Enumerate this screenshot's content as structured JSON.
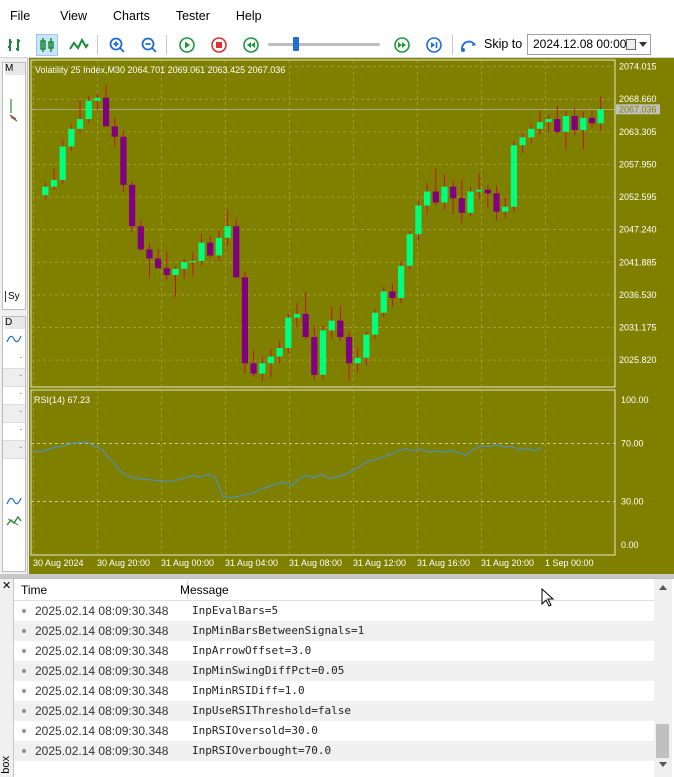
{
  "menu": [
    "File",
    "View",
    "Charts",
    "Tester",
    "Help"
  ],
  "toolbar": {
    "icons": [
      "bar-chart-icon",
      "candlestick-icon",
      "line-chart-icon",
      "zoom-in-icon",
      "zoom-out-icon",
      "play-icon",
      "stop-icon",
      "rewind-icon",
      "fast-forward-icon",
      "skip-end-icon",
      "skip-to-icon"
    ],
    "skip_label": "Skip to",
    "skip_date": "2024.12.08 00:00"
  },
  "left_strip": {
    "top_label": "M",
    "symbol_tab": "Sy",
    "data_tab": "D"
  },
  "chart_data": {
    "type": "candlestick",
    "title": "Volatility 25 Index,M30",
    "ohlc_header": "2064.701 2069.061 2063.425 2067.036",
    "price_axis": [
      "2074.015",
      "2068.660",
      "2063.305",
      "2057.950",
      "2052.595",
      "2047.240",
      "2041.885",
      "2036.530",
      "2031.175",
      "2025.820"
    ],
    "current_price_label": "2067.036",
    "ylim": [
      2021.4,
      2075.1
    ],
    "time_axis": [
      "30 Aug 2024",
      "30 Aug 20:00",
      "31 Aug 00:00",
      "31 Aug 04:00",
      "31 Aug 08:00",
      "31 Aug 12:00",
      "31 Aug 16:00",
      "31 Aug 20:00",
      "1 Sep 00:00"
    ],
    "colors": {
      "background": "#808000",
      "bull": "#00ff7f",
      "bear": "#800080",
      "grid": "#a8a854",
      "axis_text": "#ffffff",
      "rsi_line": "#4a90c9"
    },
    "candles": [
      {
        "o": 2052.9,
        "h": 2055.0,
        "l": 2052.2,
        "c": 2054.3
      },
      {
        "o": 2054.3,
        "h": 2057.3,
        "l": 2053.8,
        "c": 2055.4
      },
      {
        "o": 2055.4,
        "h": 2062.0,
        "l": 2054.8,
        "c": 2060.9
      },
      {
        "o": 2060.9,
        "h": 2064.5,
        "l": 2060.2,
        "c": 2063.8
      },
      {
        "o": 2063.8,
        "h": 2068.5,
        "l": 2063.1,
        "c": 2065.4
      },
      {
        "o": 2065.4,
        "h": 2069.2,
        "l": 2064.8,
        "c": 2068.4
      },
      {
        "o": 2068.4,
        "h": 2069.5,
        "l": 2066.9,
        "c": 2068.9
      },
      {
        "o": 2068.9,
        "h": 2071.0,
        "l": 2064.2,
        "c": 2064.2
      },
      {
        "o": 2064.2,
        "h": 2065.7,
        "l": 2060.9,
        "c": 2062.5
      },
      {
        "o": 2062.5,
        "h": 2063.5,
        "l": 2053.4,
        "c": 2054.6
      },
      {
        "o": 2054.6,
        "h": 2055.2,
        "l": 2046.8,
        "c": 2047.8
      },
      {
        "o": 2047.8,
        "h": 2048.8,
        "l": 2043.8,
        "c": 2044.0
      },
      {
        "o": 2044.0,
        "h": 2045.1,
        "l": 2039.4,
        "c": 2042.5
      },
      {
        "o": 2042.5,
        "h": 2044.1,
        "l": 2040.9,
        "c": 2040.9
      },
      {
        "o": 2040.9,
        "h": 2043.7,
        "l": 2038.9,
        "c": 2039.8
      },
      {
        "o": 2039.8,
        "h": 2041.2,
        "l": 2036.2,
        "c": 2040.8
      },
      {
        "o": 2040.8,
        "h": 2042.4,
        "l": 2039.2,
        "c": 2041.9
      },
      {
        "o": 2041.9,
        "h": 2043.5,
        "l": 2039.7,
        "c": 2042.1
      },
      {
        "o": 2042.1,
        "h": 2046.5,
        "l": 2041.2,
        "c": 2045.1
      },
      {
        "o": 2045.1,
        "h": 2046.2,
        "l": 2042.5,
        "c": 2043.0
      },
      {
        "o": 2043.0,
        "h": 2047.2,
        "l": 2042.0,
        "c": 2045.9
      },
      {
        "o": 2045.9,
        "h": 2050.5,
        "l": 2044.6,
        "c": 2047.8
      },
      {
        "o": 2047.8,
        "h": 2049.0,
        "l": 2039.4,
        "c": 2039.4
      },
      {
        "o": 2039.4,
        "h": 2040.3,
        "l": 2023.6,
        "c": 2025.3
      },
      {
        "o": 2025.3,
        "h": 2027.4,
        "l": 2023.1,
        "c": 2023.6
      },
      {
        "o": 2023.6,
        "h": 2026.4,
        "l": 2022.3,
        "c": 2025.3
      },
      {
        "o": 2025.3,
        "h": 2027.6,
        "l": 2023.0,
        "c": 2026.4
      },
      {
        "o": 2026.4,
        "h": 2029.0,
        "l": 2025.3,
        "c": 2027.8
      },
      {
        "o": 2027.8,
        "h": 2033.5,
        "l": 2026.9,
        "c": 2032.8
      },
      {
        "o": 2032.8,
        "h": 2035.2,
        "l": 2031.1,
        "c": 2033.4
      },
      {
        "o": 2033.4,
        "h": 2037.0,
        "l": 2029.2,
        "c": 2029.6
      },
      {
        "o": 2029.6,
        "h": 2031.5,
        "l": 2022.6,
        "c": 2023.4
      },
      {
        "o": 2023.4,
        "h": 2031.5,
        "l": 2022.8,
        "c": 2030.7
      },
      {
        "o": 2030.7,
        "h": 2034.5,
        "l": 2029.3,
        "c": 2032.3
      },
      {
        "o": 2032.3,
        "h": 2034.8,
        "l": 2028.9,
        "c": 2029.6
      },
      {
        "o": 2029.6,
        "h": 2030.6,
        "l": 2022.4,
        "c": 2025.3
      },
      {
        "o": 2025.3,
        "h": 2027.8,
        "l": 2023.8,
        "c": 2026.2
      },
      {
        "o": 2026.2,
        "h": 2030.5,
        "l": 2025.0,
        "c": 2030.0
      },
      {
        "o": 2030.0,
        "h": 2034.2,
        "l": 2029.3,
        "c": 2033.6
      },
      {
        "o": 2033.6,
        "h": 2037.8,
        "l": 2032.9,
        "c": 2037.1
      },
      {
        "o": 2037.1,
        "h": 2038.4,
        "l": 2034.6,
        "c": 2036.0
      },
      {
        "o": 2036.0,
        "h": 2042.0,
        "l": 2035.2,
        "c": 2041.3
      },
      {
        "o": 2041.3,
        "h": 2047.0,
        "l": 2040.6,
        "c": 2046.5
      },
      {
        "o": 2046.5,
        "h": 2052.0,
        "l": 2045.3,
        "c": 2051.2
      },
      {
        "o": 2051.2,
        "h": 2054.9,
        "l": 2049.8,
        "c": 2053.5
      },
      {
        "o": 2053.5,
        "h": 2057.3,
        "l": 2051.2,
        "c": 2051.7
      },
      {
        "o": 2051.7,
        "h": 2056.4,
        "l": 2050.5,
        "c": 2054.3
      },
      {
        "o": 2054.3,
        "h": 2055.3,
        "l": 2049.8,
        "c": 2052.4
      },
      {
        "o": 2052.4,
        "h": 2055.4,
        "l": 2048.3,
        "c": 2050.0
      },
      {
        "o": 2050.0,
        "h": 2054.3,
        "l": 2049.4,
        "c": 2053.5
      },
      {
        "o": 2053.5,
        "h": 2056.5,
        "l": 2052.2,
        "c": 2053.8
      },
      {
        "o": 2053.8,
        "h": 2054.6,
        "l": 2050.9,
        "c": 2053.2
      },
      {
        "o": 2053.2,
        "h": 2054.5,
        "l": 2048.7,
        "c": 2050.2
      },
      {
        "o": 2050.2,
        "h": 2052.5,
        "l": 2049.2,
        "c": 2051.0
      },
      {
        "o": 2051.0,
        "h": 2061.8,
        "l": 2050.2,
        "c": 2061.1
      },
      {
        "o": 2061.1,
        "h": 2063.0,
        "l": 2059.8,
        "c": 2062.4
      },
      {
        "o": 2062.4,
        "h": 2064.6,
        "l": 2061.5,
        "c": 2063.8
      },
      {
        "o": 2063.8,
        "h": 2066.8,
        "l": 2062.8,
        "c": 2064.9
      },
      {
        "o": 2064.9,
        "h": 2066.1,
        "l": 2063.2,
        "c": 2065.4
      },
      {
        "o": 2065.4,
        "h": 2067.6,
        "l": 2063.0,
        "c": 2063.3
      },
      {
        "o": 2063.3,
        "h": 2066.8,
        "l": 2060.4,
        "c": 2065.9
      },
      {
        "o": 2065.9,
        "h": 2067.2,
        "l": 2062.7,
        "c": 2063.6
      },
      {
        "o": 2063.6,
        "h": 2066.7,
        "l": 2060.4,
        "c": 2065.6
      },
      {
        "o": 2065.6,
        "h": 2066.8,
        "l": 2064.0,
        "c": 2064.7
      },
      {
        "o": 2064.7,
        "h": 2069.1,
        "l": 2063.4,
        "c": 2067.0
      }
    ],
    "rsi": {
      "label": "RSI(14) 67.23",
      "axis": [
        "100.00",
        "70.00",
        "30.00",
        "0.00"
      ],
      "levels": [
        70,
        30
      ],
      "values": [
        64.8,
        64.2,
        66.1,
        67.5,
        68.3,
        69.9,
        70.6,
        71.2,
        68.1,
        66.4,
        60.1,
        53.9,
        48.6,
        46.5,
        45.7,
        45.1,
        44.6,
        44.3,
        43.8,
        44.9,
        46.2,
        47.9,
        46.8,
        48.6,
        46.4,
        33.6,
        32.7,
        33.4,
        34.9,
        35.8,
        38.4,
        40.2,
        42.1,
        43.6,
        40.9,
        45.5,
        47.9,
        46.2,
        48.8,
        45.9,
        46.8,
        48.5,
        51.3,
        53.9,
        57.6,
        58.6,
        60.8,
        62.2,
        64.6,
        66.4,
        64.9,
        66.2,
        64.1,
        65.0,
        63.9,
        65.1,
        63.7,
        62.0,
        66.2,
        68.2,
        68.0,
        69.1,
        67.5,
        68.1,
        65.5,
        66.8,
        64.9,
        67.2
      ]
    }
  },
  "journal": {
    "columns": [
      "Time",
      "Message"
    ],
    "side_label": "box",
    "rows": [
      {
        "time": "2025.02.14 08:09:30.348",
        "message": "InpEvalBars=5"
      },
      {
        "time": "2025.02.14 08:09:30.348",
        "message": "InpMinBarsBetweenSignals=1"
      },
      {
        "time": "2025.02.14 08:09:30.348",
        "message": "InpArrowOffset=3.0"
      },
      {
        "time": "2025.02.14 08:09:30.348",
        "message": "InpMinSwingDiffPct=0.05"
      },
      {
        "time": "2025.02.14 08:09:30.348",
        "message": "InpMinRSIDiff=1.0"
      },
      {
        "time": "2025.02.14 08:09:30.348",
        "message": "InpUseRSIThreshold=false"
      },
      {
        "time": "2025.02.14 08:09:30.348",
        "message": "InpRSIOversold=30.0"
      },
      {
        "time": "2025.02.14 08:09:30.348",
        "message": "InpRSIOverbought=70.0"
      }
    ]
  }
}
